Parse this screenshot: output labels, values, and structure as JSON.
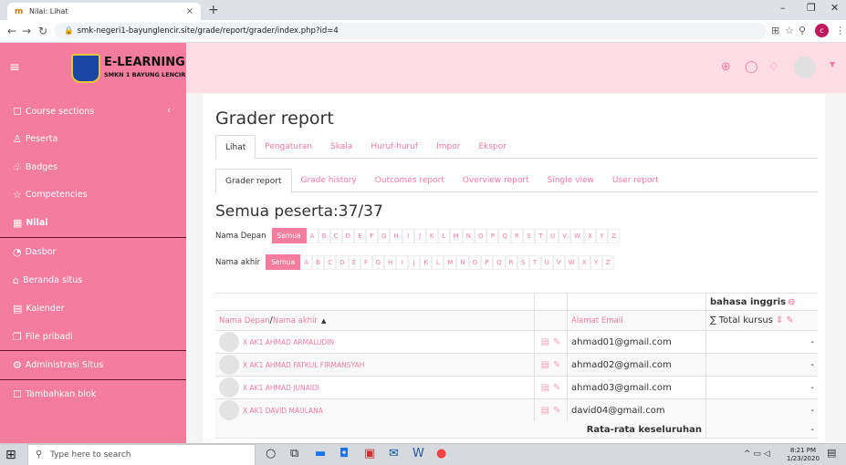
{
  "browser": {
    "tab_title": "Nilai: Lihat",
    "tab_favicon": "m",
    "url": "smk-negeri1-bayunglencir.site/grade/report/grader/index.php?id=4",
    "profile_letter": "c"
  },
  "header": {
    "brand": "E-LEARNING",
    "sub": "SMKN 1 BAYUNG LENCIR"
  },
  "sidebar": {
    "items": [
      {
        "label": "Course sections",
        "icon": "folder-icon"
      },
      {
        "label": "Peserta",
        "icon": "users-icon"
      },
      {
        "label": "Badges",
        "icon": "badge-icon"
      },
      {
        "label": "Competencies",
        "icon": "star-icon"
      },
      {
        "label": "Nilai",
        "icon": "grades-icon"
      },
      {
        "label": "Dasbor",
        "icon": "dashboard-icon"
      },
      {
        "label": "Beranda situs",
        "icon": "home-icon"
      },
      {
        "label": "Kalender",
        "icon": "calendar-icon"
      },
      {
        "label": "File pribadi",
        "icon": "file-icon"
      },
      {
        "label": "Administrasi Situs",
        "icon": "gear-icon"
      },
      {
        "label": "Tambahkan blok",
        "icon": "add-block-icon"
      }
    ]
  },
  "main": {
    "title": "Grader report",
    "tabs1": [
      "Lihat",
      "Pengaturan",
      "Skala",
      "Huruf-huruf",
      "Impor",
      "Ekspor"
    ],
    "tabs2": [
      "Grader report",
      "Grade history",
      "Outcomes report",
      "Overview report",
      "Single view",
      "User report"
    ],
    "count_title": "Semua peserta:37/37",
    "first_name_label": "Nama Depan",
    "last_name_label": "Nama akhir",
    "all_label": "Semua",
    "letters": [
      "A",
      "B",
      "C",
      "D",
      "E",
      "F",
      "G",
      "H",
      "I",
      "J",
      "K",
      "L",
      "M",
      "N",
      "O",
      "P",
      "Q",
      "R",
      "S",
      "T",
      "U",
      "V",
      "W",
      "X",
      "Y",
      "Z"
    ]
  },
  "table": {
    "category": "bahasa inggris",
    "col_first": "Nama Depan",
    "col_sep": " / ",
    "col_last": "Nama akhir",
    "sort_glyph": "▲",
    "col_email": "Alamat Email",
    "col_total": "Total kursus",
    "rows": [
      {
        "name": "X AK1 AHMAD ARMALUDIN",
        "email": "ahmad01@gmail.com",
        "total": "-"
      },
      {
        "name": "X AK1 AHMAD FATKUL FIRMANSYAH",
        "email": "ahmad02@gmail.com",
        "total": "-"
      },
      {
        "name": "X AK1 AHMAD JUNAIDI",
        "email": "ahmad03@gmail.com",
        "total": "-"
      },
      {
        "name": "X AK1 DAVID MAULANA",
        "email": "david04@gmail.com",
        "total": "-"
      }
    ],
    "avg_label": "Rata-rata keseluruhan",
    "avg_value": "-"
  },
  "taskbar": {
    "search_placeholder": "Type here to search",
    "time": "8:21 PM",
    "date": "1/23/2020"
  },
  "colors": {
    "accent": "#f47c9f",
    "header_bg": "#ffdde6"
  }
}
